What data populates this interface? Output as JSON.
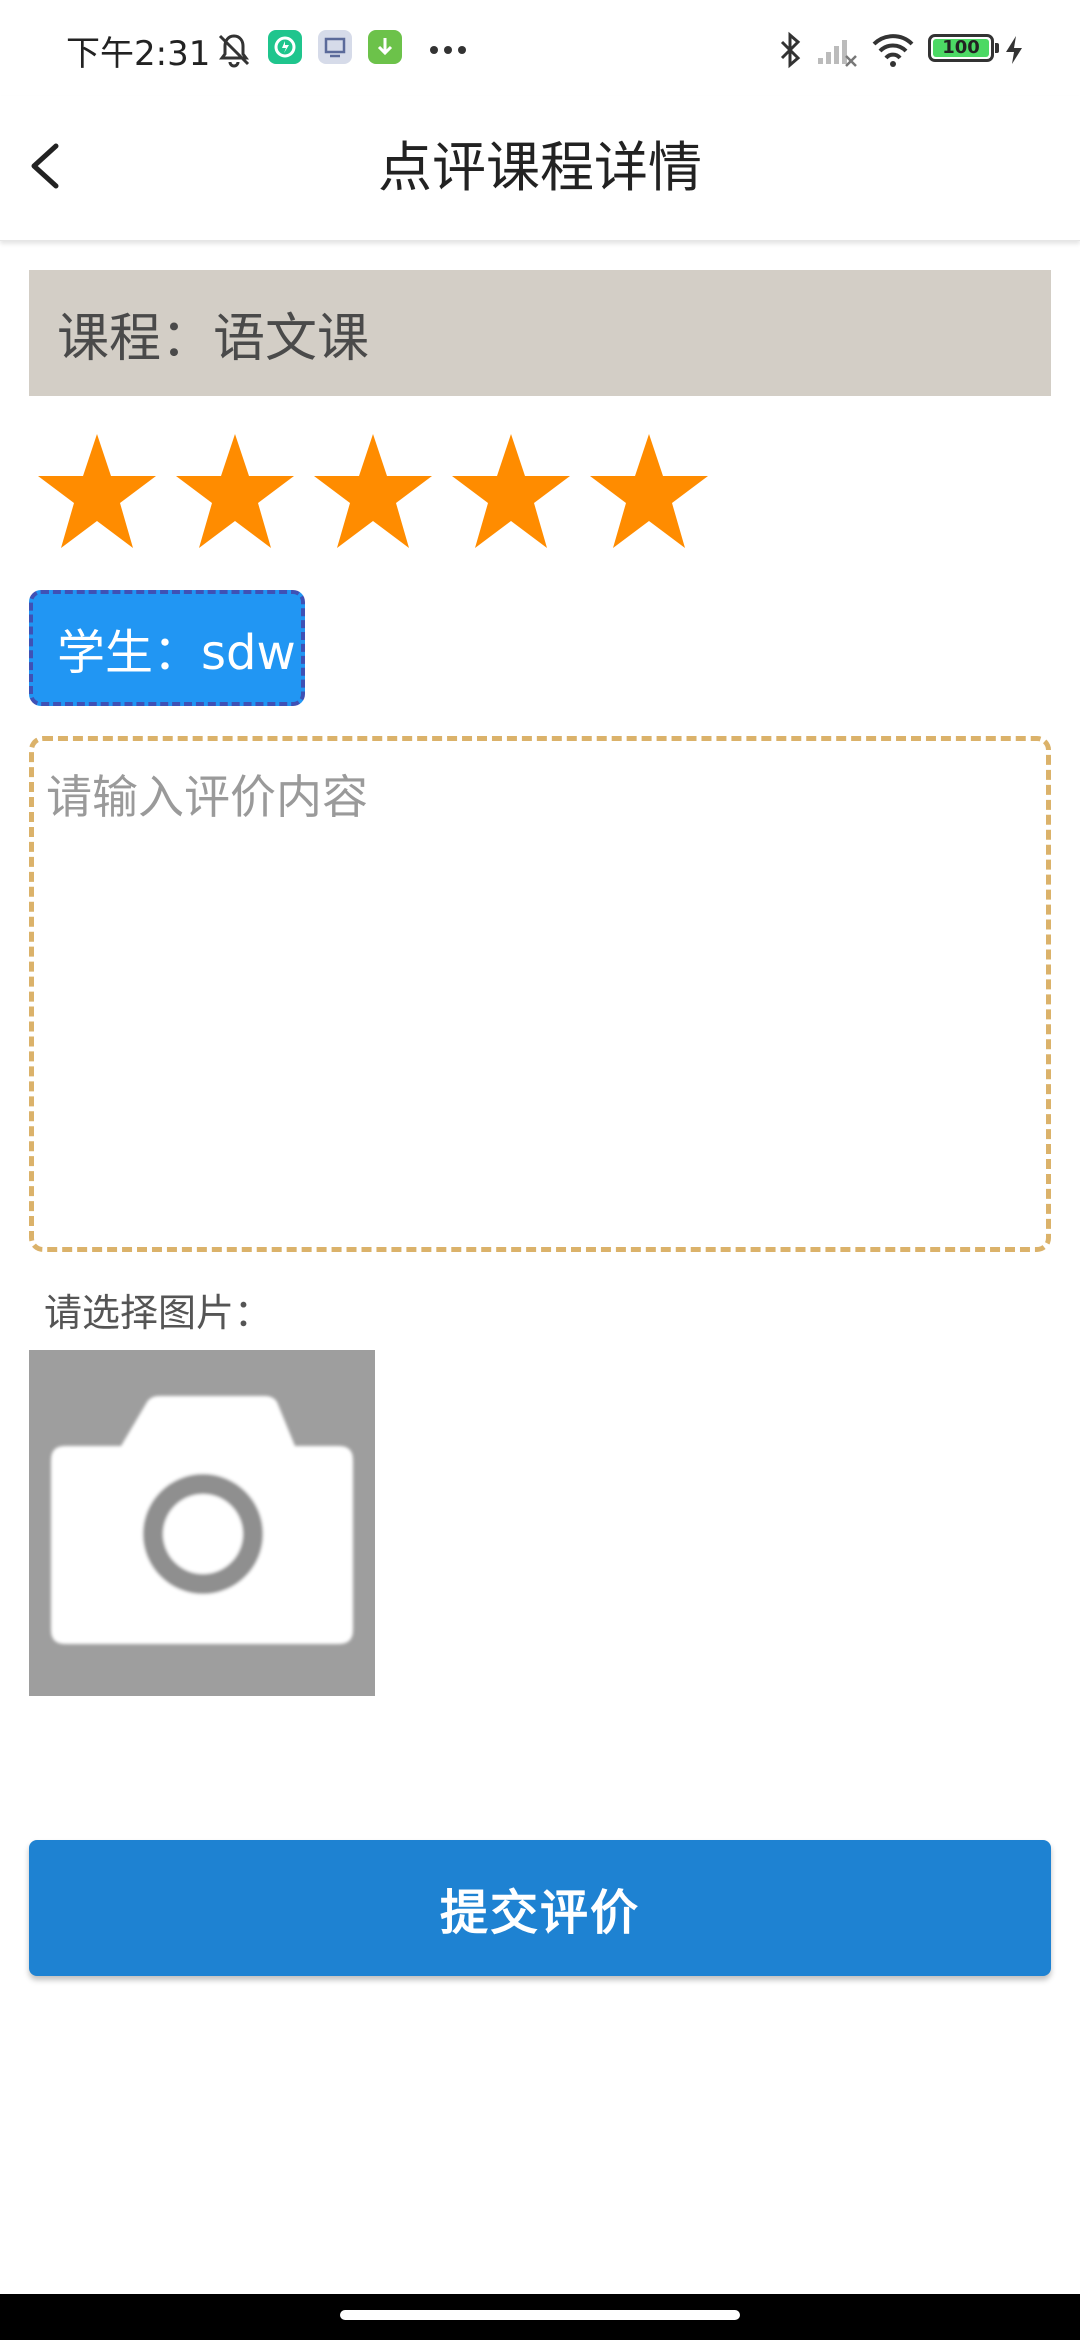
{
  "status_bar": {
    "time": "下午2:31",
    "battery": "100",
    "icons": [
      "mute-bell-icon",
      "shield-app-icon",
      "screen-app-icon",
      "download-app-icon",
      "more-dots-icon",
      "bluetooth-icon",
      "signal-icon",
      "wifi-icon",
      "battery-icon",
      "charging-icon"
    ]
  },
  "app_bar": {
    "title": "点评课程详情",
    "back_icon": "chevron-left-icon"
  },
  "course": {
    "label": "课程：语文课"
  },
  "rating": {
    "value": 5,
    "max": 5,
    "star_color": "#ff8c00"
  },
  "student": {
    "label": "学生：sdw",
    "bg_color": "#2196f3",
    "border_color": "#3f51b5"
  },
  "comment": {
    "value": "",
    "placeholder": "请输入评价内容",
    "border_color": "#dbb26a"
  },
  "image_picker": {
    "label": "请选择图片：",
    "icon": "camera-icon"
  },
  "submit": {
    "label": "提交评价",
    "color": "#1e82d2"
  }
}
